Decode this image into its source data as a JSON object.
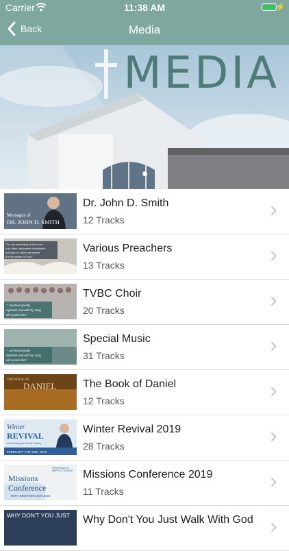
{
  "status": {
    "carrier": "Carrier",
    "time": "11:38 AM"
  },
  "nav": {
    "back_label": "Back",
    "title": "Media"
  },
  "banner": {
    "heading": "MEDIA",
    "page_dots": 1,
    "active_dot": 1
  },
  "items": [
    {
      "title": "Dr. John D. Smith",
      "tracks": "12 Tracks",
      "thumb_lines": [
        "Messages of",
        "DR. JOHN D. SMITH"
      ]
    },
    {
      "title": "Various Preachers",
      "tracks": "13 Tracks",
      "thumb_lines": [
        "\"For the preaching of the cross",
        "is to them that perish foolishness;",
        "but unto us which are saved",
        "it is the power of God.\""
      ]
    },
    {
      "title": "TVBC Choir",
      "tracks": "20 Tracks",
      "thumb_lines": [
        "\"...my heart greatly",
        "rejoiceth; and with my song",
        "will I praise him.\""
      ]
    },
    {
      "title": "Special Music",
      "tracks": "31 Tracks",
      "thumb_lines": [
        "\"...my heart greatly",
        "rejoiceth; and with my song",
        "will I praise him.\""
      ]
    },
    {
      "title": "The Book of Daniel",
      "tracks": "12 Tracks",
      "thumb_lines": [
        "THE BOOK OF",
        "DANIEL"
      ]
    },
    {
      "title": "Winter Revival 2019",
      "tracks": "28 Tracks",
      "thumb_lines": [
        "Winter",
        "REVIVAL",
        "with Evangelist Scott Pauley",
        "FEBRUARY 17th–20th, 2019"
      ]
    },
    {
      "title": "Missions Conference 2019",
      "tracks": "11 Tracks",
      "thumb_lines": [
        "TEAYS VALLEY",
        "BAPTIST CHURCH",
        "Missions",
        "Conference",
        "WITH BROTHER DON SISK"
      ]
    },
    {
      "title": "Why Don't You Just Walk With God",
      "tracks": "",
      "thumb_lines": [
        "WHY DON'T YOU JUST"
      ]
    }
  ],
  "colors": {
    "bar": "#7ea7a0",
    "banner_text": "#4f7b78",
    "chevron": "#c4c4c7"
  }
}
